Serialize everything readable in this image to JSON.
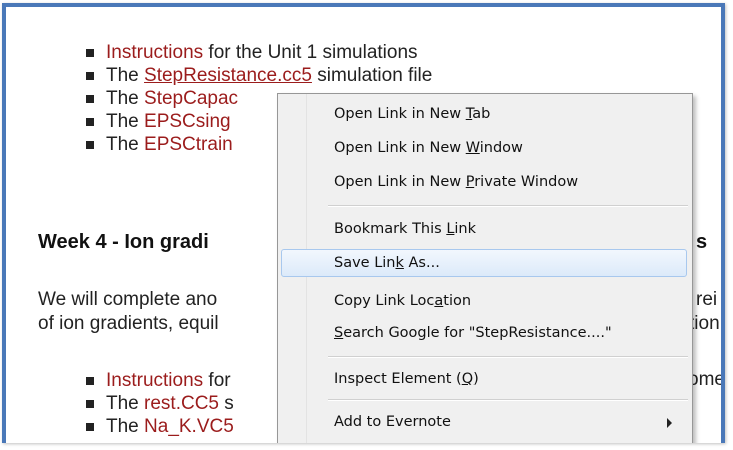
{
  "page": {
    "list1": [
      {
        "link": "Instructions",
        "rest": " for the Unit 1 simulations"
      },
      {
        "pre": "The ",
        "link": "StepResistance.cc5",
        "rest": " simulation file"
      },
      {
        "pre": "The ",
        "link": "StepCapac",
        "rest": ""
      },
      {
        "pre": "The ",
        "link": "EPSCsing",
        "rest": ""
      },
      {
        "pre": "The ",
        "link": "EPSCtrain",
        "rest": ""
      }
    ],
    "heading": "Week 4 - Ion gradi",
    "heading_tail": "s",
    "para_line1": "We will complete ano",
    "para_line1_tail": "rei",
    "para_line2": "of ion gradients, equil",
    "para_line2_tail": "tion",
    "list2": [
      {
        "link": "Instructions",
        "rest": " for",
        "tail": "ome"
      },
      {
        "pre": "The ",
        "link": "rest.CC5",
        "rest": " s"
      },
      {
        "pre": "The ",
        "link": "Na_K.VC5",
        "rest": ""
      }
    ]
  },
  "menu": {
    "items": [
      {
        "before": "Open Link in New ",
        "key": "T",
        "after": "ab"
      },
      {
        "before": "Open Link in New ",
        "key": "W",
        "after": "indow"
      },
      {
        "before": "Open Link in New ",
        "key": "P",
        "after": "rivate Window"
      },
      {
        "before": "Bookmark This ",
        "key": "L",
        "after": "ink"
      },
      {
        "before": "Save Lin",
        "key": "k",
        "after": " As..."
      },
      {
        "before": "Copy Link Loc",
        "key": "a",
        "after": "tion"
      },
      {
        "before": "",
        "key": "S",
        "after": "earch Google for \"StepResistance....\""
      },
      {
        "before": "Inspect Element (",
        "key": "Q",
        "after": ")"
      },
      {
        "before": "Add to Evernote",
        "key": "",
        "after": ""
      }
    ]
  },
  "colors": {
    "link": "#9b1c1c",
    "frame": "#4a78b8",
    "menu_bg": "#f0f0f0",
    "highlight": "#dceafa"
  }
}
